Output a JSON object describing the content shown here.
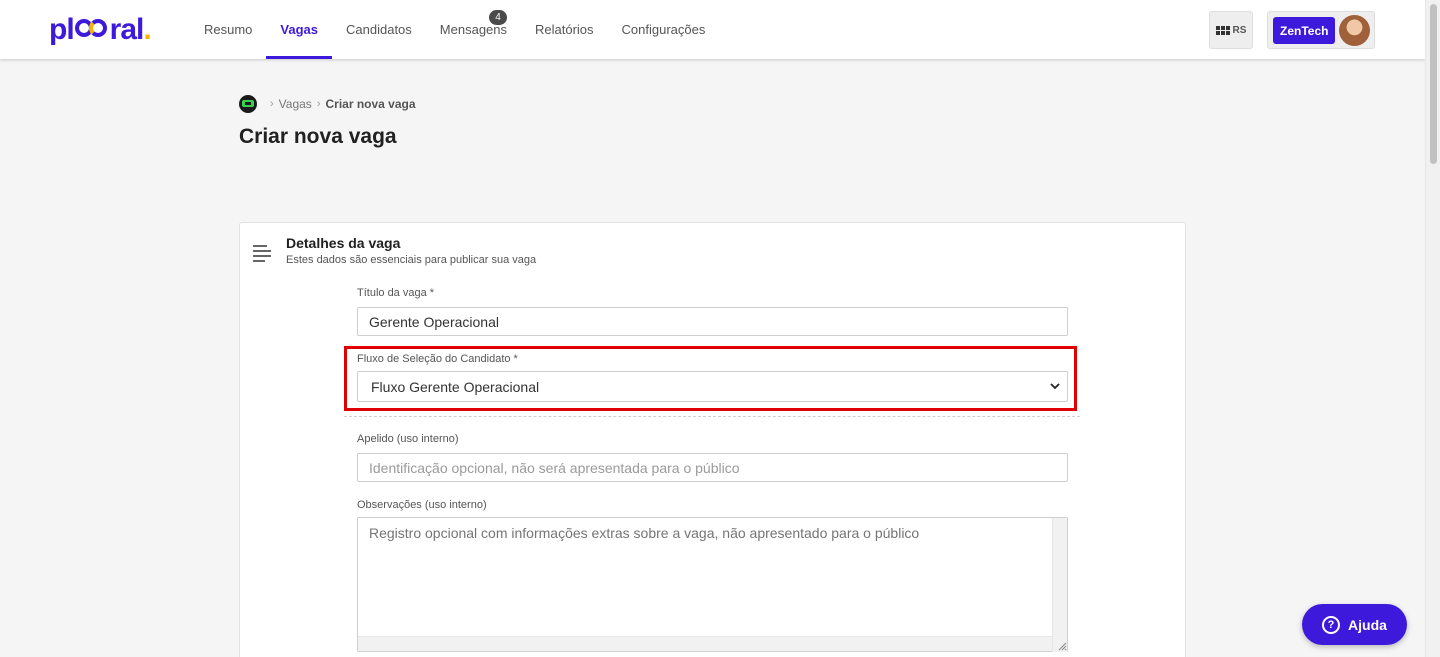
{
  "header": {
    "logo": {
      "prefix": "pl",
      "suffix": "ral",
      "dot": "."
    },
    "nav": [
      {
        "label": "Resumo",
        "active": false
      },
      {
        "label": "Vagas",
        "active": true
      },
      {
        "label": "Candidatos",
        "active": false
      },
      {
        "label": "Mensagens",
        "active": false,
        "badge": "4"
      },
      {
        "label": "Relatórios",
        "active": false
      },
      {
        "label": "Configurações",
        "active": false
      }
    ],
    "apps_initials": "RS",
    "apps_icon": "grid-icon",
    "company": "ZenTech"
  },
  "breadcrumb": {
    "home_icon": "home-icon",
    "items": [
      "Vagas",
      "Criar nova vaga"
    ]
  },
  "page_title": "Criar nova vaga",
  "section": {
    "icon": "text-lines-icon",
    "title": "Detalhes da vaga",
    "subtitle": "Estes dados são essenciais para publicar sua vaga"
  },
  "form": {
    "job_title": {
      "label": "Título da vaga *",
      "value": "Gerente Operacional"
    },
    "flow": {
      "label": "Fluxo de Seleção do Candidato *",
      "value": "Fluxo Gerente Operacional"
    },
    "nickname": {
      "label": "Apelido (uso interno)",
      "placeholder": "Identificação opcional, não será apresentada para o público"
    },
    "notes": {
      "label": "Observações (uso interno)",
      "placeholder": "Registro opcional com informações extras sobre a vaga, não apresentado para o público"
    }
  },
  "help": {
    "label": "Ajuda",
    "icon": "question-icon"
  },
  "colors": {
    "brand": "#3d19dc",
    "accent": "#f5b400",
    "highlight": "#e00000"
  }
}
